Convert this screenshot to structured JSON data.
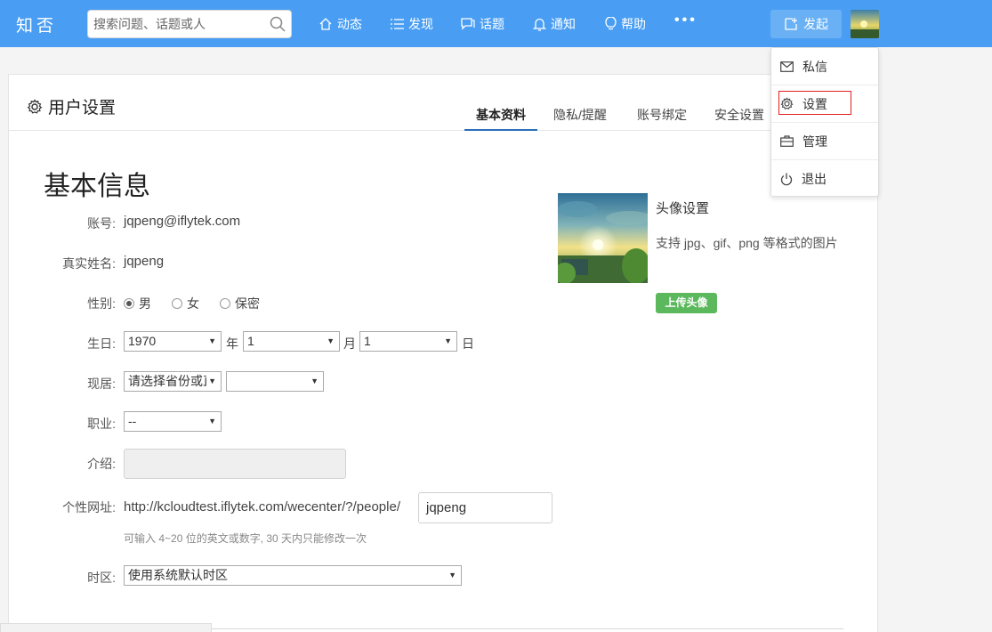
{
  "topbar": {
    "logo": "知否",
    "search_placeholder": "搜索问题、话题或人",
    "nav": [
      {
        "label": "动态",
        "icon": "home-icon"
      },
      {
        "label": "发现",
        "icon": "list-icon"
      },
      {
        "label": "话题",
        "icon": "chat-icon"
      },
      {
        "label": "通知",
        "icon": "bell-icon"
      },
      {
        "label": "帮助",
        "icon": "bulb-icon"
      }
    ],
    "more": "•••",
    "publish": "发起"
  },
  "dropdown": {
    "items": [
      {
        "label": "私信",
        "icon": "mail-icon"
      },
      {
        "label": "设置",
        "icon": "gear-icon"
      },
      {
        "label": "管理",
        "icon": "briefcase-icon"
      },
      {
        "label": "退出",
        "icon": "power-icon"
      }
    ]
  },
  "settings": {
    "title": "用户设置",
    "tabs": [
      "基本资料",
      "隐私/提醒",
      "账号绑定",
      "安全设置"
    ],
    "active_tab": "基本资料",
    "section_title": "基本信息",
    "fields": {
      "account_label": "账号:",
      "account_value": "jqpeng@iflytek.com",
      "realname_label": "真实姓名:",
      "realname_value": "jqpeng",
      "gender_label": "性别:",
      "gender_options": [
        "男",
        "女",
        "保密"
      ],
      "gender_selected": "男",
      "birthday_label": "生日:",
      "birth_year": "1970",
      "birth_year_unit": "年",
      "birth_month": "1",
      "birth_month_unit": "月",
      "birth_day": "1",
      "birth_day_unit": "日",
      "residence_label": "现居:",
      "residence_province": "请选择省份或直辖市",
      "residence_city": "",
      "job_label": "职业:",
      "job_value": "--",
      "intro_label": "介绍:",
      "url_label": "个性网址:",
      "url_prefix": "http://kcloudtest.iflytek.com/wecenter/?/people/",
      "url_value": "jqpeng",
      "url_hint": "可输入 4~20 位的英文或数字, 30 天内只能修改一次",
      "timezone_label": "时区:",
      "timezone_value": "使用系统默认时区"
    },
    "avatar": {
      "title": "头像设置",
      "desc": "支持 jpg、gif、png 等格式的图片",
      "upload": "上传头像"
    }
  },
  "colors": {
    "topbar": "#499ef3",
    "upload_button": "#5cb85c",
    "tab_underline": "#2a6fb8",
    "highlight_border": "#e02020"
  }
}
